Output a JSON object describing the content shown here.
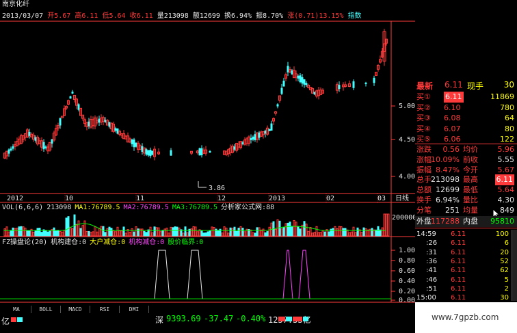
{
  "header": {
    "stock_name": "南京化纤",
    "date": "2013/03/07",
    "items": [
      {
        "label": "开",
        "value": "5.67",
        "color": "#ff3a3a"
      },
      {
        "label": "高",
        "value": "6.11",
        "color": "#ff3a3a"
      },
      {
        "label": "低",
        "value": "5.64",
        "color": "#ff3a3a"
      },
      {
        "label": "收",
        "value": "6.11",
        "color": "#ff3a3a"
      },
      {
        "label": "量",
        "value": "213098",
        "color": "#e8e8e8"
      },
      {
        "label": "额",
        "value": "12699",
        "color": "#e8e8e8"
      },
      {
        "label": "换",
        "value": "6.94%",
        "color": "#e8e8e8"
      },
      {
        "label": "振",
        "value": "8.70%",
        "color": "#e8e8e8"
      },
      {
        "label": "涨",
        "value": "(0.71)13.15%",
        "color": "#ff3a3a"
      }
    ],
    "trailing": "指数"
  },
  "price_axis": [
    "5.00",
    "4.50",
    "4.00"
  ],
  "min_price_label": "3.86",
  "x_axis": [
    "2012",
    "10",
    "11",
    "12",
    "2013",
    "02",
    "03"
  ],
  "period_label": "日线",
  "volume_axis": [
    "200000"
  ],
  "volume_header": [
    {
      "text": "VOL(6,6,6)",
      "color": "#e8e8e8"
    },
    {
      "text": "213098",
      "color": "#e8e8e8"
    },
    {
      "text": "MA1:76789.5",
      "color": "#ffff00"
    },
    {
      "text": "MA2:76789.5",
      "color": "#ff44ff"
    },
    {
      "text": "MA3:76789.5",
      "color": "#00ff00"
    },
    {
      "text": "分析家公式网:88",
      "color": "#e8e8e8"
    }
  ],
  "indicator_header": [
    {
      "text": "FZ操盘论(20)",
      "color": "#e8e8e8"
    },
    {
      "text": "机构建仓:0",
      "color": "#e8e8e8"
    },
    {
      "text": "大户减仓:0",
      "color": "#ffff00"
    },
    {
      "text": "机构减仓:0",
      "color": "#ff44ff"
    },
    {
      "text": "股价临界:0",
      "color": "#00ff00"
    }
  ],
  "indicator_axis": [
    "1.00",
    "0.80",
    "0.60",
    "0.40",
    "0.20",
    "0.00"
  ],
  "tabs": [
    "MA",
    "BOLL",
    "MACD",
    "RSI",
    "DMI"
  ],
  "status": {
    "left": "亿",
    "market": "深",
    "index": "9393.69",
    "change": "-37.47",
    "pct": "-0.40%",
    "amount": "1257.33亿"
  },
  "quote": {
    "latest": {
      "label": "最新",
      "value": "6.11",
      "label2": "现手",
      "value2": "30"
    },
    "bids": [
      {
        "label": "买①",
        "price": "6.11",
        "vol": "11869"
      },
      {
        "label": "买②",
        "price": "6.10",
        "vol": "780"
      },
      {
        "label": "买③",
        "price": "6.08",
        "vol": "64"
      },
      {
        "label": "买④",
        "price": "6.07",
        "vol": "80"
      },
      {
        "label": "买⑤",
        "price": "6.06",
        "vol": "122"
      }
    ],
    "stats": [
      {
        "l1": "涨跌",
        "v1": "0.56",
        "l2": "均价",
        "v2": "5.96"
      },
      {
        "l1": "涨幅",
        "v1": "10.09%",
        "l2": "前收",
        "v2": "5.55"
      },
      {
        "l1": "振幅",
        "v1": "8.47%",
        "l2": "今开",
        "v2": "5.67"
      },
      {
        "l1": "总手",
        "v1": "213098",
        "l2": "最高",
        "v2": "6.11"
      },
      {
        "l1": "总额",
        "v1": "12699",
        "l2": "最低",
        "v2": "5.64"
      },
      {
        "l1": "换手",
        "v1": "6.94%",
        "l2": "量比",
        "v2": "4.30"
      },
      {
        "l1": "分笔",
        "v1": "251",
        "l2": "均量",
        "v2": "849"
      }
    ],
    "outer": {
      "label": "外盘",
      "value": "117288",
      "label2": "内盘",
      "value2": "95810"
    },
    "ticks": [
      {
        "time": "14:59",
        "price": "6.11",
        "vol": "100"
      },
      {
        "time": ":26",
        "price": "6.11",
        "vol": "6"
      },
      {
        "time": ":31",
        "price": "6.11",
        "vol": "20"
      },
      {
        "time": ":36",
        "price": "6.11",
        "vol": "52"
      },
      {
        "time": ":41",
        "price": "6.11",
        "vol": "62"
      },
      {
        "time": ":46",
        "price": "6.11",
        "vol": "5"
      },
      {
        "time": ":51",
        "price": "6.11",
        "vol": "2"
      },
      {
        "time": "15:00",
        "price": "6.11",
        "vol": "30"
      }
    ]
  },
  "watermark": "www.7gpzb.com"
}
